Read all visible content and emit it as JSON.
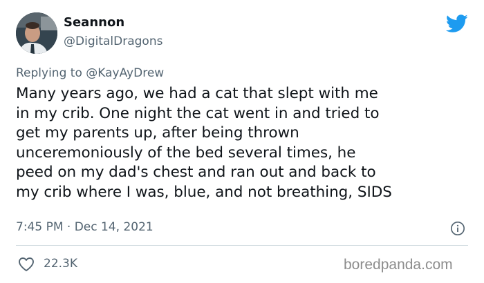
{
  "author": {
    "display_name": "Seannon",
    "handle": "@DigitalDragons"
  },
  "reply": {
    "prefix": "Replying to",
    "mention": "@KayAyDrew"
  },
  "tweet": {
    "text": "Many years ago, we had a cat that slept with me\nin my crib. One night the cat went in and tried to\nget my parents up, after being thrown\nunceremoniously of the bed several times, he\npeed on my dad's chest and ran out and back to\nmy crib where I was, blue, and not breathing, SIDS",
    "timestamp": "7:45 PM · Dec 14, 2021",
    "likes": "22.3K"
  },
  "watermark": "boredpanda.com",
  "icons": {
    "logo": "twitter-bird-icon",
    "info": "info-icon",
    "like": "heart-icon"
  },
  "colors": {
    "brand": "#1d9bf0",
    "text_primary": "#0f1419",
    "text_secondary": "#536471",
    "divider": "#cfd9de"
  }
}
